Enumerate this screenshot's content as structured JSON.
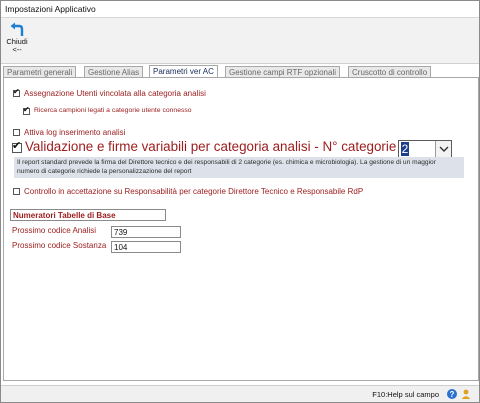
{
  "window": {
    "title": "Impostazioni Applicativo"
  },
  "toolbar": {
    "close_label_line1": "Chiudi",
    "close_label_line2": "<--"
  },
  "tabs": [
    {
      "label": "Parametri generali"
    },
    {
      "label": "Gestione Alias"
    },
    {
      "label": "Parametri ver AC"
    },
    {
      "label": "Gestione campi RTF opzionali"
    },
    {
      "label": "Cruscotto di controllo"
    }
  ],
  "active_tab": "Parametri ver AC",
  "settings": {
    "assegnazione_label": "Assegnazione Utenti vincolata alla categoria analisi",
    "assegnazione_checked": true,
    "ricerca_label": "Ricerca campioni legati a categorie utente connesso",
    "ricerca_checked": true,
    "attiva_log_label": "Attiva log inserimento analisi",
    "attiva_log_checked": false,
    "validazione_label": "Validazione e firme variabili per categoria analisi - N° categorie :",
    "validazione_checked": true,
    "n_categorie_value": "2",
    "validazione_note_line1": "Il report standard prevede la firma del Direttore tecnico e dei responsabili di 2 categorie (es. chimica e microbiologia). La gestione di un maggior",
    "validazione_note_line2": "numero di categorie richiede la personalizzazione del report",
    "controllo_label": "Controllo in accettazione su Responsabilità per categorie Direttore Tecnico e Responsabile RdP",
    "controllo_checked": false
  },
  "numeratori": {
    "header": "Numeratori Tabelle di Base",
    "analisi_label": "Prossimo codice Analisi",
    "analisi_value": "739",
    "sostanza_label": "Prossimo codice Sostanza",
    "sostanza_value": "104"
  },
  "statusbar": {
    "help_text": "F10:Help sul campo",
    "help_icon": "help-icon",
    "user_icon": "user-icon"
  },
  "colors": {
    "label_red": "#9b1c1c",
    "tab_active_text": "#1a2b5a",
    "note_bg": "#dde2ea",
    "selection_blue": "#1d3e8a"
  }
}
